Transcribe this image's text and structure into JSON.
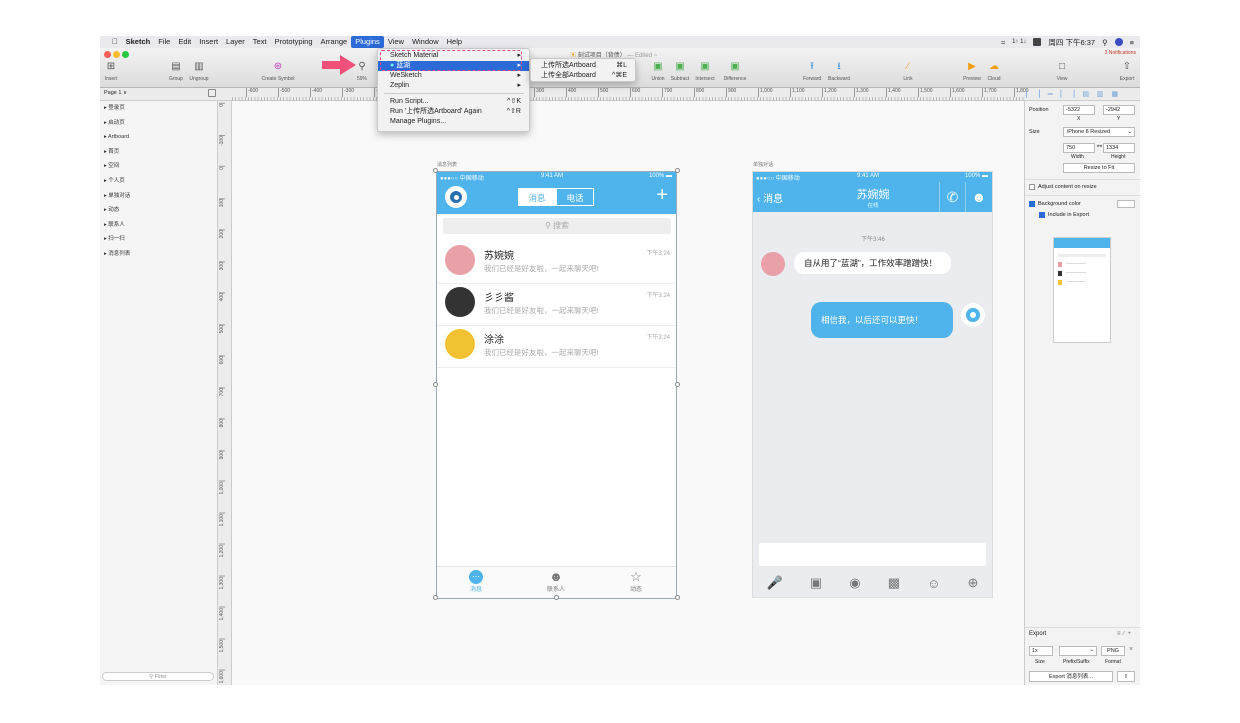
{
  "menubar": {
    "app": "Sketch",
    "items": [
      "File",
      "Edit",
      "Insert",
      "Layer",
      "Text",
      "Prototyping",
      "Arrange",
      "Plugins",
      "View",
      "Window",
      "Help"
    ],
    "active": "Plugins",
    "clock": "周四 下午6:37",
    "net": "1↑ 1↓"
  },
  "toolbar": {
    "document_title": "刻试项目（背债）",
    "edited": "— Edited ~",
    "notifications": "3 Notifications",
    "zoom": "59%",
    "tools": [
      {
        "label": "Insert",
        "icon": "plus-square-icon"
      },
      {
        "label": "Group",
        "icon": "group-icon"
      },
      {
        "label": "Ungroup",
        "icon": "ungroup-icon"
      },
      {
        "label": "Create Symbol",
        "icon": "symbol-icon"
      },
      {
        "label": "Union",
        "icon": "union-icon"
      },
      {
        "label": "Subtract",
        "icon": "subtract-icon"
      },
      {
        "label": "Intersect",
        "icon": "intersect-icon"
      },
      {
        "label": "Difference",
        "icon": "difference-icon"
      },
      {
        "label": "Forward",
        "icon": "forward-icon"
      },
      {
        "label": "Backward",
        "icon": "backward-icon"
      },
      {
        "label": "Link",
        "icon": "link-icon"
      },
      {
        "label": "Preview",
        "icon": "play-icon"
      },
      {
        "label": "Cloud",
        "icon": "cloud-icon"
      },
      {
        "label": "View",
        "icon": "view-icon"
      },
      {
        "label": "Export",
        "icon": "export-icon"
      }
    ]
  },
  "plugins_menu": {
    "items": [
      {
        "label": "Sketch Material",
        "arrow": true
      },
      {
        "label": "蓝湖",
        "arrow": true,
        "highlighted": true
      },
      {
        "label": "WeSketch",
        "arrow": true
      },
      {
        "label": "Zeplin",
        "arrow": true
      },
      {
        "label": "Run Script...",
        "shortcut": "^⇧K"
      },
      {
        "label": "Run '上传所选Artboard' Again",
        "shortcut": "^⇧R"
      },
      {
        "label": "Manage Plugins..."
      }
    ],
    "submenu": [
      {
        "label": "上传所选Artboard",
        "shortcut": "⌘L"
      },
      {
        "label": "上传全部Artboard",
        "shortcut": "^⌘E"
      }
    ]
  },
  "ruler": {
    "h_ticks": [
      "-600",
      "-500",
      "-400",
      "-300",
      "-200",
      "-100",
      "0",
      "100",
      "200",
      "300",
      "400",
      "500",
      "600",
      "700",
      "800",
      "900",
      "1,000",
      "1,100",
      "1,200",
      "1,300",
      "1,400",
      "1,500",
      "1,600",
      "1,700",
      "1,800"
    ],
    "v_ticks": [
      "0",
      "-100",
      "0",
      "100",
      "200",
      "300",
      "400",
      "500",
      "600",
      "700",
      "800",
      "900",
      "1,000",
      "1,100",
      "1,200",
      "1,300",
      "1,400",
      "1,500",
      "1,600"
    ]
  },
  "layers": {
    "page": "Page 1 ∨",
    "items": [
      "登录页",
      "启动页",
      "Artboard",
      "首页",
      "空间",
      "个人页",
      "单独对话",
      "动态",
      "联系人",
      "扫一扫",
      "消息列表"
    ],
    "filter_placeholder": "Filter"
  },
  "inspector": {
    "position_label": "Position",
    "x": "-5322",
    "y": "-2942",
    "x_label": "X",
    "y_label": "Y",
    "size_label": "Size",
    "size_preset": "iPhone 8 Resized",
    "width": "750",
    "height": "1334",
    "width_label": "Width",
    "height_label": "Height",
    "resize_button": "Resize to Fit",
    "adjust_label": "Adjust content on resize",
    "bg_label": "Background color",
    "include_export": "Include in Export",
    "export_title": "Export",
    "scale": "1x",
    "format": "PNG",
    "size_col": "Size",
    "prefix_col": "Prefix/Suffix",
    "format_col": "Format",
    "export_button": "Export 消息列表..."
  },
  "phone1": {
    "artboard_label": "消息列表",
    "carrier": "●●●○○ 中国移动",
    "time": "9:41 AM",
    "battery": "100%",
    "tab_msg": "消息",
    "tab_call": "电话",
    "plus": "+",
    "search": "搜索",
    "chats": [
      {
        "name": "苏婉婉",
        "preview": "我们已经是好友啦，一起来聊天吧!",
        "time": "下午3:24",
        "avatar": "#e9a0a8"
      },
      {
        "name": "彡彡酱",
        "preview": "我们已经是好友啦，一起来聊天吧!",
        "time": "下午3:24",
        "avatar": "#333333"
      },
      {
        "name": "涂涂",
        "preview": "我们已经是好友啦，一起来聊天吧!",
        "time": "下午3:24",
        "avatar": "#f1c232"
      }
    ],
    "tabs": [
      "消息",
      "联系人",
      "动态"
    ],
    "accent": "#4fb3ec"
  },
  "phone2": {
    "artboard_label": "单独对话",
    "carrier": "●●●○○ 中国移动",
    "time": "9:41 AM",
    "battery": "100%",
    "back": "消息",
    "contact_name": "苏婉婉",
    "status": "在线",
    "timestamp": "下午3:46",
    "msg_in": "自从用了“蓝湖”，工作效率蹭蹭快！",
    "msg_out": "相信我，以后还可以更快！"
  }
}
